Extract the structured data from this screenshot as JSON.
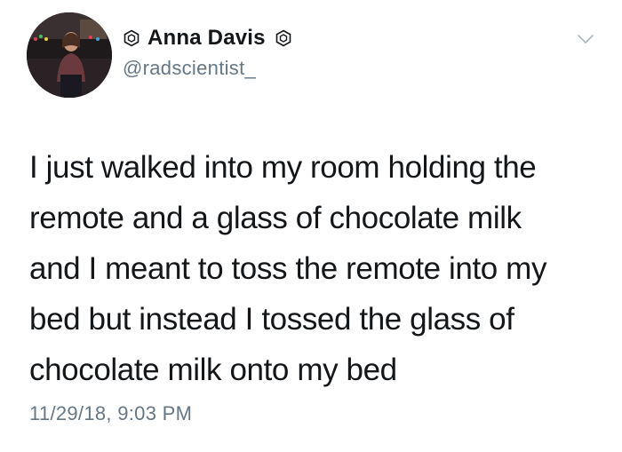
{
  "tweet": {
    "author": {
      "display_name": "Anna Davis",
      "handle": "@radscientist_"
    },
    "text_lines": [
      "I just walked into my room holding the",
      "remote and a glass of chocolate milk",
      "and I meant to toss the remote into my",
      "bed but instead I tossed the glass of",
      "chocolate milk onto my bed"
    ],
    "timestamp": "11/29/18, 9:03 PM"
  },
  "icons": {
    "badge": "hexagon-badge-icon",
    "menu": "chevron-down-icon"
  },
  "colors": {
    "text": "#14171a",
    "secondary": "#657786",
    "background": "#ffffff"
  }
}
